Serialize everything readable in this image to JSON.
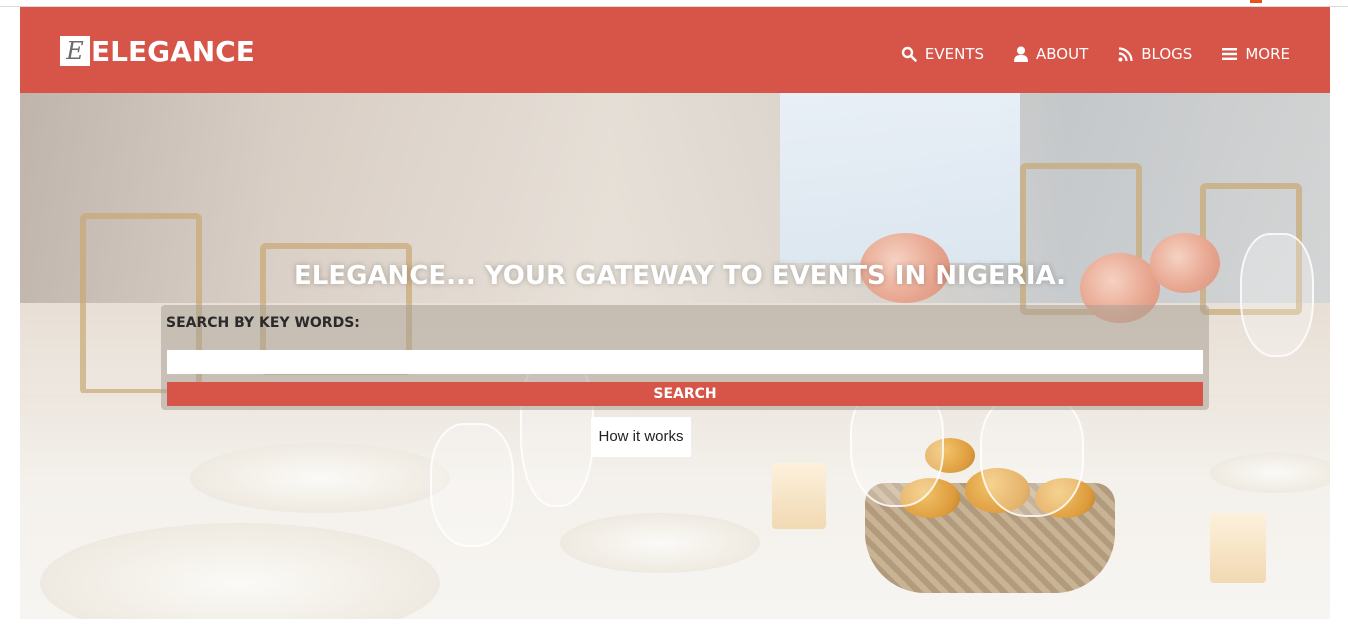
{
  "brand": {
    "logo_letter": "E",
    "name": "ELEGANCE"
  },
  "nav": {
    "items": [
      {
        "label": "EVENTS",
        "icon": "search-icon"
      },
      {
        "label": "ABOUT",
        "icon": "user-icon"
      },
      {
        "label": "BLOGS",
        "icon": "rss-icon"
      },
      {
        "label": "MORE",
        "icon": "menu-icon"
      }
    ]
  },
  "hero": {
    "headline": "ELEGANCE... YOUR GATEWAY TO EVENTS IN NIGERIA.",
    "search_label": "SEARCH BY KEY WORDS:",
    "search_value": "",
    "search_placeholder": "",
    "search_button": "SEARCH",
    "how_it_works": "How it works"
  },
  "colors": {
    "brand": "#d65548",
    "text_on_brand": "#ffffff"
  }
}
